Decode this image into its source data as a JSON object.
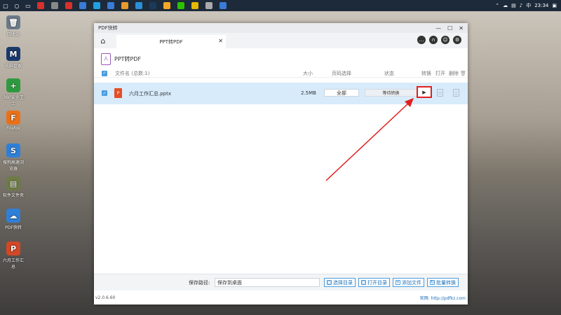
{
  "taskbar": {
    "search_icon": "search-icon",
    "apps": [
      {
        "name": "app-red",
        "color": "#d9302c"
      },
      {
        "name": "app-gray",
        "color": "#888888"
      },
      {
        "name": "app-youku",
        "color": "#d9302c"
      },
      {
        "name": "app-edge",
        "color": "#3a7bd5"
      },
      {
        "name": "app-qq",
        "color": "#1fa0e3"
      },
      {
        "name": "app-blue",
        "color": "#3a7bd5"
      },
      {
        "name": "app-orange",
        "color": "#e89a2a"
      },
      {
        "name": "app-photo",
        "color": "#2a8fd8"
      },
      {
        "name": "app-ps",
        "color": "#1b3a5c"
      },
      {
        "name": "app-emoji",
        "color": "#f5a623"
      },
      {
        "name": "app-wechat",
        "color": "#2dc100"
      },
      {
        "name": "app-yellow",
        "color": "#e6b800"
      },
      {
        "name": "app-chrome",
        "color": "#aaaaaa"
      },
      {
        "name": "app-pdf",
        "color": "#3a7bd5"
      }
    ],
    "time": "23:34"
  },
  "desktop_icons": [
    {
      "label": "回收站",
      "glyph": "🗑",
      "color": "#6c7a89"
    },
    {
      "label": "电脑管家",
      "glyph": "M",
      "color": "#1a3a6b"
    },
    {
      "label": "360安全卫士",
      "glyph": "+",
      "color": "#2e9a3f"
    },
    {
      "label": "Firefox",
      "glyph": "F",
      "color": "#e8711a"
    },
    {
      "label": "搜狗高速浏览器",
      "glyph": "S",
      "color": "#2f7fd7"
    },
    {
      "label": "软件文件夹",
      "glyph": "▤",
      "color": "#6d7b45"
    },
    {
      "label": "PDF快转",
      "glyph": "☁",
      "color": "#2f7fd7"
    },
    {
      "label": "六月工作汇总",
      "glyph": "P",
      "color": "#d24726"
    }
  ],
  "window": {
    "title": "PDF快转",
    "tab_label": "PPT转PDF",
    "tool_title": "PPT转PDF",
    "columns": {
      "filename": "文件名 (总数:1)",
      "size": "大小",
      "page_select": "页码选择",
      "status": "状态",
      "convert": "转换",
      "open": "打开",
      "delete": "删除"
    },
    "file": {
      "name": "六月工作汇总.pptx",
      "size": "2.5MB",
      "page_select": "全部",
      "status": "等待转换",
      "play": "▶"
    },
    "footer": {
      "path_label": "保存路径:",
      "path_value": "保存到桌面",
      "btn_choose": "选择目录",
      "btn_open": "打开目录",
      "btn_add": "添加文件",
      "btn_batch": "批量转换"
    },
    "version": "v2.0.6.60",
    "website": "官网: http://pdfkz.com"
  },
  "colors": {
    "accent": "#4a9de0",
    "selected_row": "#d7ebfb",
    "highlight_red": "#e02020"
  }
}
